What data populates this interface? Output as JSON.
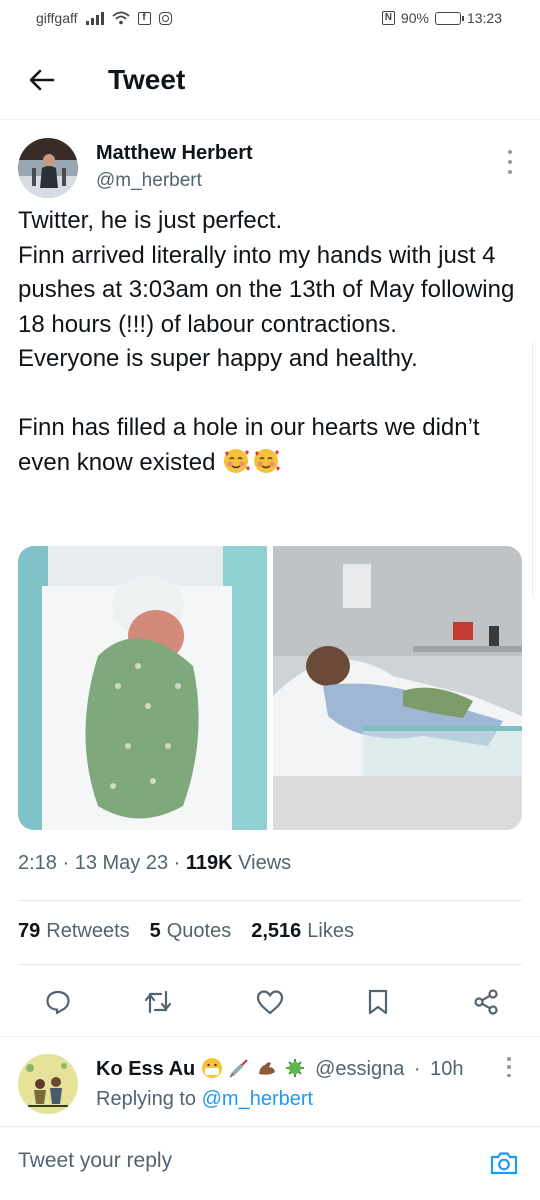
{
  "status_bar": {
    "carrier": "giffgaff",
    "battery": "90%",
    "battery_level": 0.9,
    "time": "13:23"
  },
  "header": {
    "title": "Tweet"
  },
  "tweet": {
    "author_name": "Matthew Herbert",
    "author_handle": "@m_herbert",
    "text": "Twitter, he is just perfect.\nFinn arrived literally into my hands with just 4 pushes at 3:03am on the 13th of May following 18 hours (!!!) of labour contractions.\nEveryone is super happy and healthy.\n\nFinn has filled a hole in our hearts we didn’t even know existed",
    "emoji": [
      "smiling-face-with-hearts-icon",
      "smiling-face-with-hearts-icon"
    ],
    "time": "2:18",
    "date": "13 May 23",
    "views_count": "119K",
    "views_label": "Views",
    "retweets_count": "79",
    "retweets_label": "Retweets",
    "quotes_count": "5",
    "quotes_label": "Quotes",
    "likes_count": "2,516",
    "likes_label": "Likes"
  },
  "reply": {
    "author_name": "Ko Ess Au",
    "emoji": [
      "face-with-medical-mask-icon",
      "syringe-icon",
      "flexed-biceps-icon",
      "microbe-icon"
    ],
    "author_handle": "@essigna",
    "separator": "·",
    "age": "10h",
    "replying_prefix": "Replying to",
    "replying_to": "@m_herbert"
  },
  "composer": {
    "placeholder": "Tweet your reply"
  },
  "colors": {
    "accent": "#1d9bf0",
    "text": "#0f1419",
    "secondary": "#536471"
  }
}
